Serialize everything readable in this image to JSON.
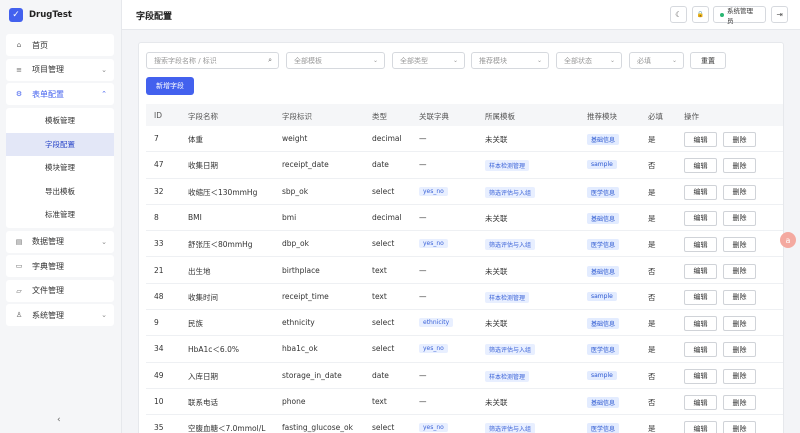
{
  "app": {
    "name": "DrugTest",
    "logo_glyph": "✓"
  },
  "sidebar": {
    "items": [
      {
        "icon": "home-icon",
        "glyph": "⌂",
        "label": "首页"
      },
      {
        "icon": "list-icon",
        "glyph": "≡",
        "label": "项目管理",
        "chevron": "⌄"
      },
      {
        "icon": "settings-icon",
        "glyph": "⚙",
        "label": "表单配置",
        "chevron": "⌃",
        "children": [
          "模板管理",
          "字段配置",
          "模块管理",
          "导出模板",
          "标准管理"
        ]
      },
      {
        "icon": "data-icon",
        "glyph": "▤",
        "label": "数据管理",
        "chevron": "⌄"
      },
      {
        "icon": "book-icon",
        "glyph": "▭",
        "label": "字典管理"
      },
      {
        "icon": "folder-icon",
        "glyph": "▱",
        "label": "文件管理"
      },
      {
        "icon": "user-icon",
        "glyph": "♙",
        "label": "系统管理",
        "chevron": "⌄"
      }
    ],
    "collapse_glyph": "‹"
  },
  "header": {
    "title": "字段配置",
    "theme_glyph": "☾",
    "lock_glyph": "🔒",
    "user": "系统管理员",
    "logout_glyph": "⇥"
  },
  "filters": {
    "search_placeholder": "搜索字段名称 / 标识",
    "search_glyph": "⌕",
    "template": "全部模板",
    "type": "全部类型",
    "module": "推荐模块",
    "status": "全部状态",
    "required": "必填",
    "reset": "重置",
    "arrow": "⌄"
  },
  "add_button": "新增字段",
  "table": {
    "columns": [
      "ID",
      "字段名称",
      "字段标识",
      "类型",
      "关联字典",
      "所属模板",
      "推荐模块",
      "必填",
      "操作"
    ],
    "rows": [
      {
        "id": "7",
        "name": "体重",
        "key": "weight",
        "type": "decimal",
        "dict": "—",
        "dict_tag": false,
        "tpl": "未关联",
        "tpl_tag": false,
        "module": "基础信息",
        "required": "是"
      },
      {
        "id": "47",
        "name": "收集日期",
        "key": "receipt_date",
        "type": "date",
        "dict": "—",
        "dict_tag": false,
        "tpl": "样本检测管理",
        "tpl_tag": true,
        "module": "sample",
        "required": "否"
      },
      {
        "id": "32",
        "name": "收缩压＜130mmHg",
        "key": "sbp_ok",
        "type": "select",
        "dict": "yes_no",
        "dict_tag": true,
        "tpl": "筛选评估与入组",
        "tpl_tag": true,
        "module": "医学信息",
        "required": "是"
      },
      {
        "id": "8",
        "name": "BMI",
        "key": "bmi",
        "type": "decimal",
        "dict": "—",
        "dict_tag": false,
        "tpl": "未关联",
        "tpl_tag": false,
        "module": "基础信息",
        "required": "是"
      },
      {
        "id": "33",
        "name": "舒张压＜80mmHg",
        "key": "dbp_ok",
        "type": "select",
        "dict": "yes_no",
        "dict_tag": true,
        "tpl": "筛选评估与入组",
        "tpl_tag": true,
        "module": "医学信息",
        "required": "是"
      },
      {
        "id": "21",
        "name": "出生地",
        "key": "birthplace",
        "type": "text",
        "dict": "—",
        "dict_tag": false,
        "tpl": "未关联",
        "tpl_tag": false,
        "module": "基础信息",
        "required": "否"
      },
      {
        "id": "48",
        "name": "收集时间",
        "key": "receipt_time",
        "type": "text",
        "dict": "—",
        "dict_tag": false,
        "tpl": "样本检测管理",
        "tpl_tag": true,
        "module": "sample",
        "required": "否"
      },
      {
        "id": "9",
        "name": "民族",
        "key": "ethnicity",
        "type": "select",
        "dict": "ethnicity",
        "dict_tag": true,
        "tpl": "未关联",
        "tpl_tag": false,
        "module": "基础信息",
        "required": "是"
      },
      {
        "id": "34",
        "name": "HbA1c＜6.0%",
        "key": "hba1c_ok",
        "type": "select",
        "dict": "yes_no",
        "dict_tag": true,
        "tpl": "筛选评估与入组",
        "tpl_tag": true,
        "module": "医学信息",
        "required": "是"
      },
      {
        "id": "49",
        "name": "入库日期",
        "key": "storage_in_date",
        "type": "date",
        "dict": "—",
        "dict_tag": false,
        "tpl": "样本检测管理",
        "tpl_tag": true,
        "module": "sample",
        "required": "否"
      },
      {
        "id": "10",
        "name": "联系电话",
        "key": "phone",
        "type": "text",
        "dict": "—",
        "dict_tag": false,
        "tpl": "未关联",
        "tpl_tag": false,
        "module": "基础信息",
        "required": "否"
      },
      {
        "id": "35",
        "name": "空腹血糖＜7.0mmol/L",
        "key": "fasting_glucose_ok",
        "type": "select",
        "dict": "yes_no",
        "dict_tag": true,
        "tpl": "筛选评估与入组",
        "tpl_tag": true,
        "module": "医学信息",
        "required": "是"
      }
    ],
    "edit_label": "编辑",
    "delete_label": "删除"
  },
  "float_badge": "a"
}
